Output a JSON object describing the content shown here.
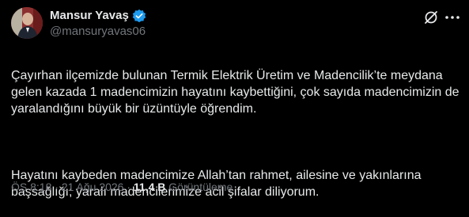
{
  "author": {
    "name": "Mansur Yavaş",
    "handle": "@mansuryavas06",
    "verified": true
  },
  "icons": {
    "verified": "verified-badge-icon",
    "grok": "grok-icon",
    "more": "more-options-icon"
  },
  "colors": {
    "background": "#000000",
    "text": "#e7e9ea",
    "secondary_text": "#71767b",
    "verified_badge": "#1d9bf0"
  },
  "tweet": {
    "paragraph1": "Çayırhan ilçemizde bulunan Termik Elektrik Üretim ve Madencilik’te meydana gelen kazada 1 madencimizin hayatını kaybettiğini, çok sayıda madencimizin de yaralandığını büyük bir üzüntüyle öğrendim.",
    "paragraph2": "Hayatını kaybeden madencimize Allah’tan rahmet, ailesine ve yakınlarına başsağlığı; yaralı madencilerimize acil şifalar diliyorum."
  },
  "meta": {
    "time": "ÖS 8:18",
    "separator": "·",
    "date": "21 Ağu 2026",
    "views_count": "11,4 B",
    "views_label": "Görüntüleme"
  }
}
